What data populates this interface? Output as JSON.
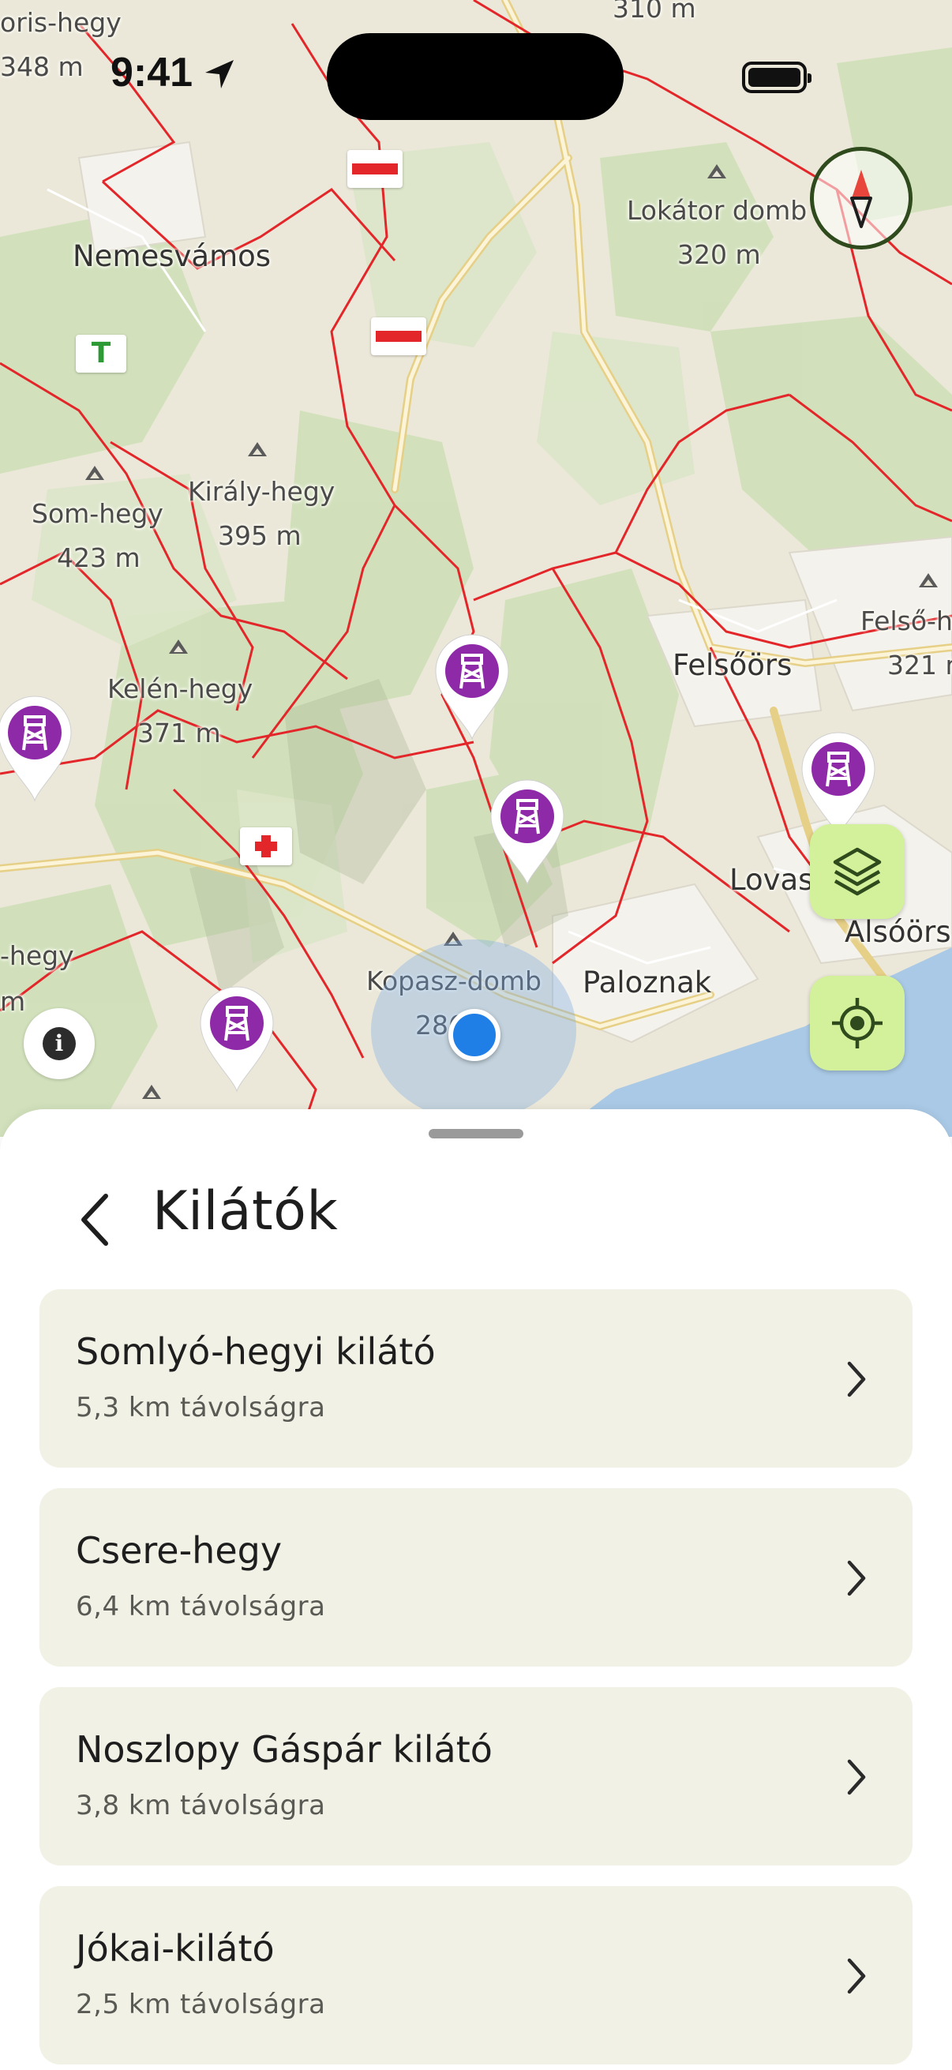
{
  "status_bar": {
    "time": "9:41"
  },
  "map": {
    "labels": {
      "oris_hegy": "oris-hegy",
      "m348": "348 m",
      "m310": "310 m",
      "nemesvamos": "Nemesvámos",
      "lokator_domb": "Lokátor domb",
      "m320": "320 m",
      "som_hegy": "Som-hegy",
      "m423": "423 m",
      "kiraly_hegy": "Király-hegy",
      "m395": "395 m",
      "kelen_hegy": "Kelén-hegy",
      "m371": "371 m",
      "felsoors": "Felsőörs",
      "felso_h": "Felső-h",
      "m321": "321 m",
      "lovas": "Lovas",
      "alsoors": "Alsóörs",
      "hegy": "-hegy",
      "m_left": "m",
      "kopasz_domb": "Kopasz-domb",
      "m286": "286",
      "paloznak": "Paloznak"
    },
    "icons": [
      "viewpoint-icon",
      "layers-icon",
      "locate-icon",
      "compass-icon",
      "info-icon"
    ]
  },
  "sheet": {
    "title": "Kilátók",
    "items": [
      {
        "name": "Somlyó-hegyi kilátó",
        "distance": "5,3 km távolságra"
      },
      {
        "name": "Csere-hegy",
        "distance": "6,4 km távolságra"
      },
      {
        "name": "Noszlopy Gáspár kilátó",
        "distance": "3,8 km távolságra"
      },
      {
        "name": "Jókai-kilátó",
        "distance": "2,5 km távolságra"
      }
    ]
  },
  "colors": {
    "accent_fab": "#d3f09a",
    "viewpoint_pin": "#8e2aa8",
    "trail_red": "#e3262a",
    "user_location": "#1f7fe6",
    "card_bg": "#f2f1e6"
  }
}
